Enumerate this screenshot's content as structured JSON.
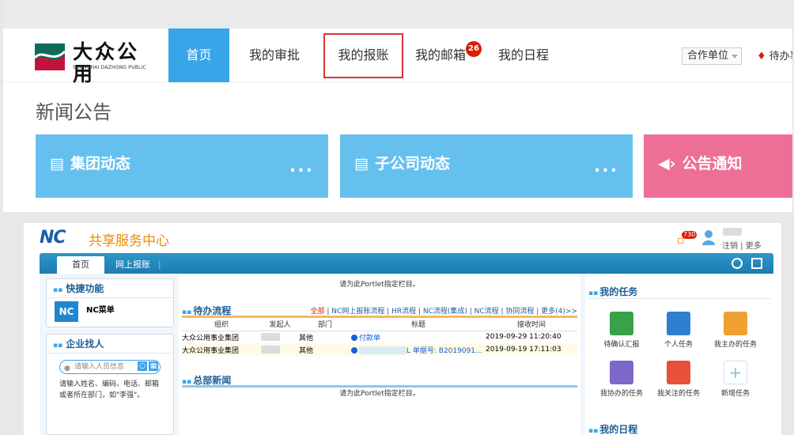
{
  "top": {
    "logo": {
      "cn": "大众公用",
      "en": "SHANGHAI DAZHONG PUBLIC"
    },
    "nav": [
      {
        "label": "首页",
        "active": true
      },
      {
        "label": "我的审批"
      },
      {
        "label": "我的报账",
        "highlighted": true
      },
      {
        "label": "我的邮箱",
        "badge": "26"
      },
      {
        "label": "我的日程"
      }
    ],
    "partner_select": "合作单位",
    "todo_link": "待办事",
    "news_title": "新闻公告",
    "cards": [
      {
        "title": "集团动态",
        "more": "...",
        "color": "#66c0ee",
        "icon": "document-icon"
      },
      {
        "title": "子公司动态",
        "more": "...",
        "color": "#66c0ee",
        "icon": "document-icon"
      },
      {
        "title": "公告通知",
        "color": "#ee6f96",
        "icon": "speaker-icon"
      }
    ]
  },
  "nc": {
    "brand": "NC",
    "subtitle": "共享服务中心",
    "msg_count": "730",
    "user_links": "注销 | 更多",
    "tabs": [
      {
        "label": "首页",
        "active": true
      },
      {
        "label": "网上报账"
      }
    ],
    "quick": {
      "title": "快捷功能",
      "item_icon": "NC",
      "item_label": "NC菜单"
    },
    "finder": {
      "title": "企业找人",
      "placeholder": "请输入人员信息",
      "tip": "请输入姓名、编码、电话、邮箱或者所在部门，如\"李强\"。"
    },
    "portlet_placeholder": "请为此Portlet指定栏目。",
    "todo": {
      "title": "待办流程",
      "filters": "全部 | NC网上报账流程 | HR流程 | NC流程(集成) | NC流程 | 协同流程 | 更多(4)>>",
      "filter_active": "全部",
      "filter_rest": " | NC网上报账流程 | HR流程 | NC流程(集成) | NC流程 | 协同流程 | 更多(4)>>",
      "columns": [
        "组织",
        "发起人",
        "部门",
        "标题",
        "接收时间"
      ],
      "rows": [
        {
          "org": "大众公用事业集团",
          "dept": "其他",
          "title": "付款单",
          "time": "2019-09-29 11:20:40"
        },
        {
          "org": "大众公用事业集团",
          "dept": "其他",
          "title": "L 单据号: B2019091...",
          "time": "2019-09-19 17:11:03"
        }
      ]
    },
    "news": {
      "title": "总部新闻",
      "placeholder": "请为此Portlet指定栏目。"
    },
    "tasks": {
      "title": "我的任务",
      "items": [
        {
          "label": "待确认汇报",
          "color": "#3aa14a",
          "icon": "checklist-icon"
        },
        {
          "label": "个人任务",
          "color": "#2e7fd0",
          "icon": "person-task-icon"
        },
        {
          "label": "我主办的任务",
          "color": "#f0a030",
          "icon": "team-task-icon"
        },
        {
          "label": "我协办的任务",
          "color": "#7b68c8",
          "icon": "assist-task-icon"
        },
        {
          "label": "我关注的任务",
          "color": "#e8503a",
          "icon": "eye-icon"
        },
        {
          "label": "新增任务",
          "color": "#ffffff",
          "icon": "plus-icon"
        }
      ]
    },
    "schedule_title": "我的日程"
  }
}
